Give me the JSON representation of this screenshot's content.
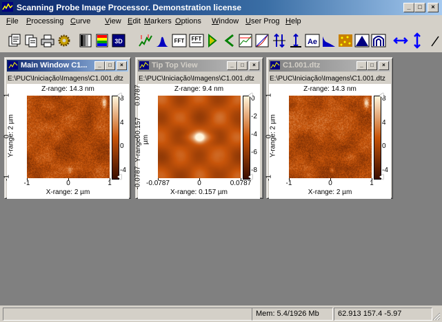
{
  "app": {
    "title": "Scanning Probe Image Processor. Demonstration license",
    "controls": [
      "_",
      "□",
      "×"
    ]
  },
  "menu": [
    {
      "label": "File",
      "u": "F",
      "rest": "ile"
    },
    {
      "label": "Processing",
      "u": "P",
      "rest": "rocessing"
    },
    {
      "label": "Curve",
      "u": "C",
      "rest": "urve"
    },
    {
      "label": "View",
      "u": "V",
      "rest": "iew"
    },
    {
      "label": "Edit",
      "u": "E",
      "rest": "dit"
    },
    {
      "label": "Markers",
      "u": "M",
      "rest": "arkers"
    },
    {
      "label": "Options",
      "u": "O",
      "rest": "ptions"
    },
    {
      "label": "Window",
      "u": "W",
      "rest": "indow"
    },
    {
      "label": "User Prog",
      "u": "U",
      "rest": "ser Prog"
    },
    {
      "label": "Help",
      "u": "H",
      "rest": "elp"
    }
  ],
  "toolbar": {
    "icons": [
      "open-file-icon",
      "copy-icon",
      "print-icon",
      "settings-gear-icon",
      "grayscale-palette-icon",
      "color-palette-icon",
      "3d-view-icon",
      "roughness-icon",
      "histogram-icon",
      "fft-icon",
      "inverse-fft-icon",
      "rotate-left-icon",
      "rotate-right-icon",
      "profile-icon",
      "curve-icon",
      "flip-vertical-icon",
      "adjust-height-icon",
      "ae-icon",
      "filter-icon",
      "particles-icon",
      "peak-icon",
      "arch-icon",
      "horizontal-arrows-icon",
      "vertical-arrows-icon",
      "draw-line-icon"
    ],
    "fft_label": "FFT",
    "ae_label": "Ae",
    "threed_label": "3D"
  },
  "windows": [
    {
      "title": "Main Window C1...",
      "path": "E:\\PUC\\Iniciação\\Imagens\\C1.001.dtz",
      "zrange": "Z-range: 14.3 nm",
      "xrange": "X-range: 2 µm",
      "yrange": "Y-range: 2 µm",
      "xticks": [
        "-1",
        "0",
        "1"
      ],
      "yticks": [
        "1",
        "0",
        "-1"
      ],
      "cticks": [
        "8",
        "4",
        "0",
        "-4"
      ],
      "active": true
    },
    {
      "title": "Tip Top View",
      "path": "E:\\PUC\\Iniciação\\Imagens\\C1.001.dtz",
      "zrange": "Z-range: 9.4 nm",
      "xrange": "X-range: 0.157 µm",
      "yrange": "Y-range: 0.157 µm",
      "xticks": [
        "-0.0787",
        "0",
        "0.0787"
      ],
      "yticks": [
        "0.0787",
        "0",
        "-0.0787"
      ],
      "cticks": [
        "0",
        "-2",
        "-4",
        "-6",
        "-8"
      ],
      "active": false
    },
    {
      "title": "C1.001.dtz",
      "path": "E:\\PUC\\Iniciação\\Imagens\\C1.001.dtz",
      "zrange": "Z-range: 14.3 nm",
      "xrange": "X-range: 2 µm",
      "yrange": "Y-range: 2 µm",
      "xticks": [
        "-1",
        "0",
        "1"
      ],
      "yticks": [
        "1",
        "0",
        "-1"
      ],
      "cticks": [
        "8",
        "4",
        "0",
        "-4"
      ],
      "active": false
    }
  ],
  "status": {
    "main": "",
    "mem": "Mem: 5.4/1926 Mb",
    "coords": "62.913 157.4 -5.97"
  }
}
